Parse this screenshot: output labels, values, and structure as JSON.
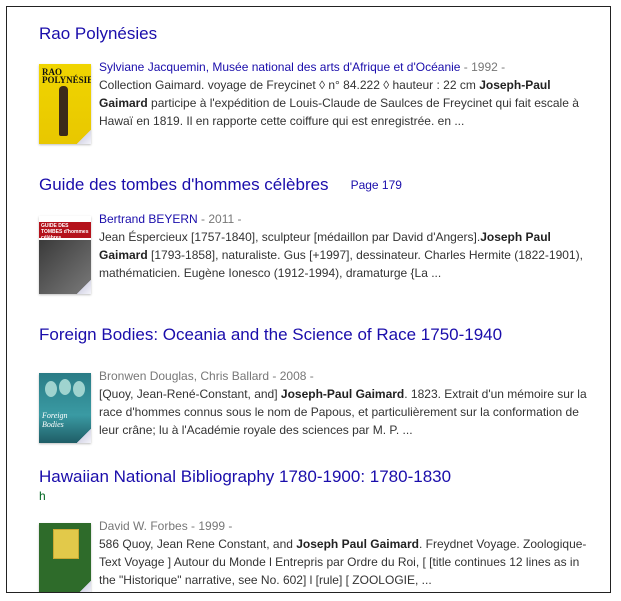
{
  "results": [
    {
      "title": "Rao Polynésies",
      "author": "Sylviane Jacquemin, Musée national des arts d'Afrique et d'Océanie",
      "year": " - 1992 - ",
      "snippet_pre": "Collection Gaimard. voyage de Freycinet ◊ n° 84.222 ◊ hauteur : 22 cm ",
      "snippet_bold": "Joseph-Paul Gaimard",
      "snippet_post": " participe à l'expédition de Louis-Claude de Saulces de Freycinet qui fait escale à Hawaï en 1819. Il en rapporte cette coiffure qui est enregistrée. en ...",
      "thumb_text": "RAO POLYNÉSIES"
    },
    {
      "title": "Guide des tombes d'hommes célèbres",
      "page": "Page 179",
      "author": "Bertrand BEYERN",
      "year": " - 2011 - ",
      "snippet_pre": "Jean Ésperciеux [1757-1840], sculpteur [médaillon par David d'Angers].",
      "snippet_bold": "Joseph Paul Gaimard",
      "snippet_post": " [1793-1858], naturaliste. Gus [+1997], dessinateur. Charles Hermite (1822-1901), mathématicien. Eugène Ionesco (1912-1994), dramaturge {La ...",
      "thumb_text": "GUIDE DES TOMBES d'hommes célèbres"
    },
    {
      "title": "Foreign Bodies: Oceania and the Science of Race 1750-1940",
      "author": "Bronwen Douglas, Chris Ballard",
      "year": " - 2008 - ",
      "snippet_pre": "[Quoy, Jean-René-Constant, and] ",
      "snippet_bold": "Joseph-Paul Gaimard",
      "snippet_post": ". 1823. Extrait d'un mémoire sur la race d'hommes connus sous le nom de Papous, et particulièrement sur la conformation de leur crâne; lu à l'Académie royale des sciences par M. P. ...",
      "thumb_text": "Foreign Bodies"
    },
    {
      "title": "Hawaiian National Bibliography 1780-1900: 1780-1830",
      "green": "h",
      "author": "David W. Forbes",
      "year": " - 1999 - ",
      "snippet_pre": "586 Quoy, Jean Rene Constant, and ",
      "snippet_bold": "Joseph Paul Gaimard",
      "snippet_post": ". Freydnet Voyage. Zoologique-Text Voyage ] Autour du Monde l Entrepris par Ordre du Roi, [ [title continues 12 lines as in the \"Historique\" narrative, see No. 602] l [rule] [ ZOOLOGIE, ..."
    }
  ]
}
